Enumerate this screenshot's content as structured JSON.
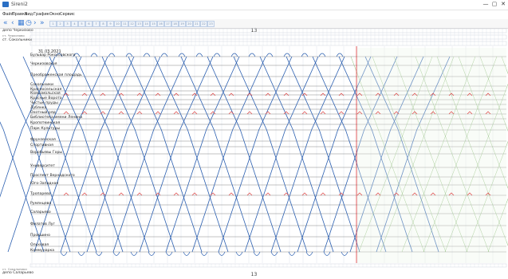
{
  "window": {
    "title": "Sireni2",
    "minimize_glyph": "—",
    "maximize_glyph": "▢",
    "close_glyph": "✕"
  },
  "menu": [
    {
      "label": "Файл"
    },
    {
      "label": "Правка"
    },
    {
      "label": "Вид"
    },
    {
      "label": "График"
    },
    {
      "label": "Окно"
    },
    {
      "label": "Сервис"
    }
  ],
  "toolbar": {
    "icons": [
      {
        "name": "first-page-icon",
        "glyph": "«"
      },
      {
        "name": "prev-page-icon",
        "glyph": "‹"
      },
      {
        "name": "grid-view-icon",
        "glyph": "▦"
      },
      {
        "name": "clock-icon",
        "glyph": "◷"
      },
      {
        "name": "next-page-icon",
        "glyph": "›"
      },
      {
        "name": "last-page-icon",
        "glyph": "»"
      }
    ],
    "numbers": [
      "1",
      "2",
      "3",
      "4",
      "5",
      "6",
      "7",
      "8",
      "9",
      "10",
      "11",
      "12",
      "13",
      "14",
      "15",
      "16",
      "17",
      "18",
      "19",
      "20",
      "21",
      "22",
      "23"
    ]
  },
  "header": {
    "depot_top": "депо Черкизово",
    "depot_top_sub": "ст. Черкизово",
    "station_top": "ст. Сокольники",
    "hour_top": "13",
    "date": "31.03.2021"
  },
  "footer": {
    "station_bottom": "ст. Сокольники",
    "depot_bottom": "депо Саларьево",
    "hour_bottom": "13"
  },
  "stations": [
    {
      "label": "Бульвар Рокоссовского"
    },
    {
      "label": "Черкизовская"
    },
    {
      "label": "Преображенская площадь"
    },
    {
      "label": "Сокольники"
    },
    {
      "label": "Красносельская"
    },
    {
      "label": "Комсомольская"
    },
    {
      "label": "Красные Ворота"
    },
    {
      "label": "Чистые пруды"
    },
    {
      "label": "Лубянка"
    },
    {
      "label": "Охотный ряд"
    },
    {
      "label": "Библиотека имени Ленина"
    },
    {
      "label": "Кропоткинская"
    },
    {
      "label": "Парк Культуры"
    },
    {
      "label": "Фрунзенская"
    },
    {
      "label": "Спортивная"
    },
    {
      "label": "Воробьевы Горы"
    },
    {
      "label": "Университет"
    },
    {
      "label": "Проспект Вернадского"
    },
    {
      "label": "Юго-Западная"
    },
    {
      "label": "Тропарево"
    },
    {
      "label": "Румянцево"
    },
    {
      "label": "Саларьево"
    },
    {
      "label": "Филатов Луг"
    },
    {
      "label": "Прокшино"
    },
    {
      "label": "Ольховая"
    },
    {
      "label": "Коммунарка"
    }
  ],
  "colors": {
    "blue_line": "#2b5fb0",
    "green_line": "#6aa84f",
    "red_marker": "#e04040",
    "grid": "#d6dbe6",
    "now_line": "#e02020"
  }
}
